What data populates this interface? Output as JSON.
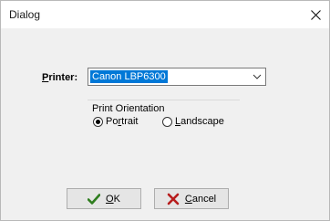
{
  "window": {
    "title": "Dialog"
  },
  "printer": {
    "label_first": "P",
    "label_rest": "rinter:",
    "selected": "Canon LBP6300"
  },
  "orientation": {
    "group_label": "Print Orientation",
    "portrait": {
      "pre": "Po",
      "mnemonic": "r",
      "post": "trait",
      "checked": true
    },
    "landscape": {
      "mnemonic": "L",
      "post": "andscape",
      "checked": false
    }
  },
  "buttons": {
    "ok": {
      "mnemonic": "O",
      "rest": "K"
    },
    "cancel": {
      "mnemonic": "C",
      "rest": "ancel"
    }
  },
  "colors": {
    "selection": "#0078d7",
    "ok_icon": "#2e7d1e",
    "cancel_icon": "#b71c1c"
  },
  "icons": {
    "close": "close-icon",
    "dropdown": "chevron-down-icon",
    "ok": "check-icon",
    "cancel": "x-icon"
  }
}
